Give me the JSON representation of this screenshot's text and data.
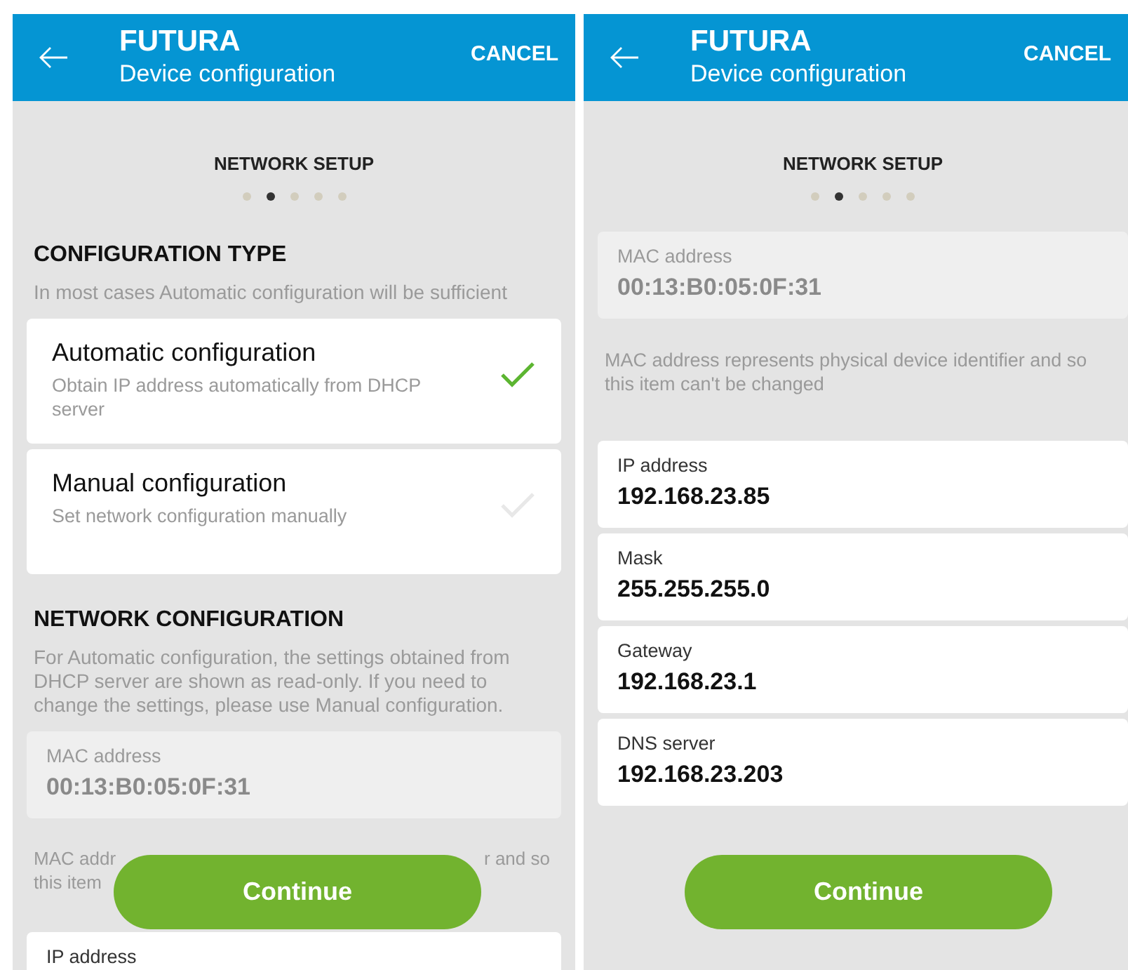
{
  "screens": [
    {
      "header": {
        "title": "FUTURA",
        "subtitle": "Device configuration",
        "action": "CANCEL"
      },
      "step": {
        "title": "NETWORK SETUP",
        "dots": [
          {
            "selected": false
          },
          {
            "selected": true
          },
          {
            "selected": false
          },
          {
            "selected": false
          },
          {
            "selected": false
          }
        ]
      },
      "blocks": [
        {
          "kind": "heading",
          "title": "CONFIGURATION TYPE",
          "description": "In most cases Automatic configuration will be sufficient"
        },
        {
          "kind": "options",
          "items": [
            {
              "title": "Automatic configuration",
              "description": "Obtain IP address automatically from DHCP server",
              "selected": true
            },
            {
              "title": "Manual configuration",
              "description": "Set network configuration manually",
              "selected": false
            }
          ]
        },
        {
          "kind": "heading",
          "title": "NETWORK CONFIGURATION",
          "description": "For Automatic configuration, the settings obtained from DHCP server are shown as read-only. If you need to change the settings, please use Manual configuration."
        },
        {
          "kind": "readonly",
          "label": "MAC address",
          "value": "00:13:B0:05:0F:31"
        },
        {
          "kind": "partial_note",
          "lines": [
            {
              "left": "MAC addr",
              "right": "r and so"
            },
            {
              "left": "this item"
            }
          ]
        },
        {
          "kind": "field",
          "label": "IP address"
        }
      ],
      "continue_button": "Continue"
    },
    {
      "header": {
        "title": "FUTURA",
        "subtitle": "Device configuration",
        "action": "CANCEL"
      },
      "step": {
        "title": "NETWORK SETUP",
        "dots": [
          {
            "selected": false
          },
          {
            "selected": true
          },
          {
            "selected": false
          },
          {
            "selected": false
          },
          {
            "selected": false
          }
        ]
      },
      "blocks": [
        {
          "kind": "readonly",
          "label": "MAC address",
          "value": "00:13:B0:05:0F:31"
        },
        {
          "kind": "note",
          "text": "MAC address represents physical device identifier and so this item can't be changed"
        },
        {
          "kind": "field",
          "label": "IP address",
          "value": "192.168.23.85"
        },
        {
          "kind": "field",
          "label": "Mask",
          "value": "255.255.255.0"
        },
        {
          "kind": "field",
          "label": "Gateway",
          "value": "192.168.23.1"
        },
        {
          "kind": "field",
          "label": "DNS server",
          "value": "192.168.23.203"
        }
      ],
      "continue_button": "Continue"
    }
  ]
}
